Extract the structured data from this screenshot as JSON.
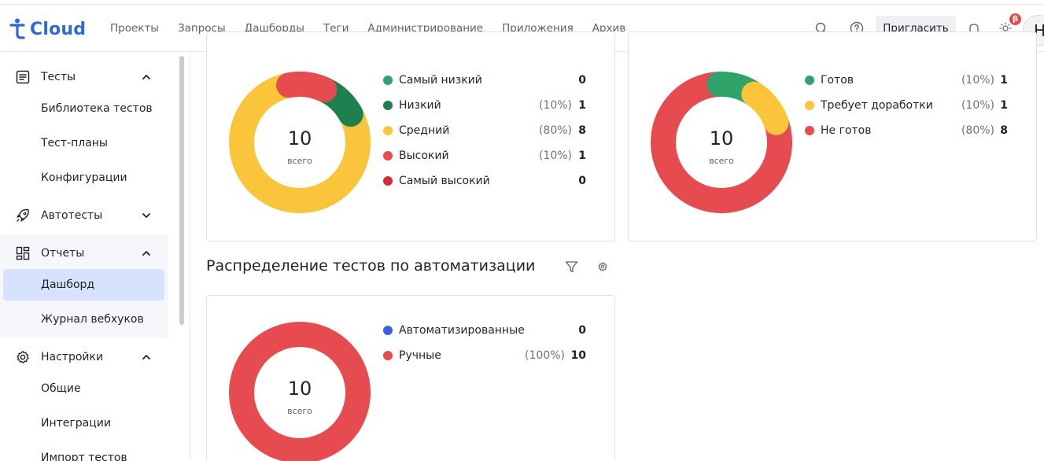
{
  "app": {
    "logo_text": "Cloud"
  },
  "nav": {
    "items": [
      "Проекты",
      "Запросы",
      "Дашборды",
      "Теги",
      "Администрирование",
      "Приложения",
      "Архив"
    ]
  },
  "header": {
    "invite_label": "Пригласить",
    "beta_badge": "β",
    "avatar_initial": "Н"
  },
  "sidebar": {
    "sections": [
      {
        "label": "Тесты",
        "icon": "document-list-icon",
        "expanded": true,
        "items": [
          "Библиотека тестов",
          "Тест-планы",
          "Конфигурации"
        ]
      },
      {
        "label": "Автотесты",
        "icon": "rocket-icon",
        "expanded": false,
        "items": []
      },
      {
        "label": "Отчеты",
        "icon": "dashboard-grid-icon",
        "expanded": true,
        "items": [
          "Дашборд",
          "Журнал вебхуков"
        ],
        "active_item": "Дашборд"
      },
      {
        "label": "Настройки",
        "icon": "gear-icon",
        "expanded": true,
        "items": [
          "Общие",
          "Интеграции",
          "Импорт тестов"
        ]
      }
    ]
  },
  "widgets": {
    "priority": {
      "total": "10",
      "total_caption": "всего",
      "legend": [
        {
          "name": "Самый низкий",
          "pct": "",
          "count": "0",
          "color": "#2ea36a"
        },
        {
          "name": "Низкий",
          "pct": "(10%)",
          "count": "1",
          "color": "#1e7f4f"
        },
        {
          "name": "Средний",
          "pct": "(80%)",
          "count": "8",
          "color": "#fbc53b"
        },
        {
          "name": "Высокий",
          "pct": "(10%)",
          "count": "1",
          "color": "#e54b4f"
        },
        {
          "name": "Самый высокий",
          "pct": "",
          "count": "0",
          "color": "#d12d33"
        }
      ]
    },
    "status": {
      "total": "10",
      "total_caption": "всего",
      "legend": [
        {
          "name": "Готов",
          "pct": "(10%)",
          "count": "1",
          "color": "#2ea36a"
        },
        {
          "name": "Требует доработки",
          "pct": "(10%)",
          "count": "1",
          "color": "#fbc53b"
        },
        {
          "name": "Не готов",
          "pct": "(80%)",
          "count": "8",
          "color": "#e54b4f"
        }
      ]
    },
    "automation": {
      "title": "Распределение тестов по автоматизации",
      "total": "10",
      "total_caption": "всего",
      "legend": [
        {
          "name": "Автоматизированные",
          "pct": "",
          "count": "0",
          "color": "#3b5fe0"
        },
        {
          "name": "Ручные",
          "pct": "(100%)",
          "count": "10",
          "color": "#e54b4f"
        }
      ]
    }
  },
  "chart_data": [
    {
      "type": "pie",
      "categories": [
        "Самый низкий",
        "Низкий",
        "Средний",
        "Высокий",
        "Самый высокий"
      ],
      "values": [
        0,
        1,
        8,
        1,
        0
      ]
    },
    {
      "type": "pie",
      "categories": [
        "Готов",
        "Требует доработки",
        "Не готов"
      ],
      "values": [
        1,
        1,
        8
      ]
    },
    {
      "type": "pie",
      "categories": [
        "Автоматизированные",
        "Ручные"
      ],
      "values": [
        0,
        10
      ]
    }
  ]
}
